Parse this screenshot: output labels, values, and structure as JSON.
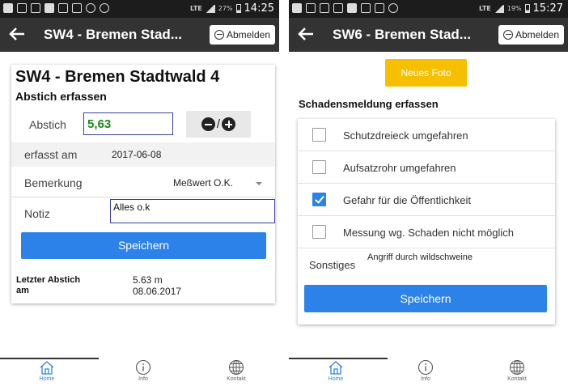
{
  "left": {
    "status": {
      "battery": "27%",
      "time": "14:25",
      "network": "LTE"
    },
    "appbar": {
      "title": "SW4 - Bremen Stad...",
      "logout_label": "Abmelden"
    },
    "page_title": "SW4 - Bremen Stadtwald 4",
    "section_title": "Abstich erfassen",
    "abstich": {
      "label": "Abstich",
      "value": "5,63",
      "stepper_separator": "/"
    },
    "erfasst": {
      "label": "erfasst am",
      "value": "2017-06-08"
    },
    "bemerkung": {
      "label": "Bemerkung",
      "selected": "Meßwert O.K."
    },
    "notiz": {
      "label": "Notiz",
      "value": "Alles o.k"
    },
    "save_label": "Speichern",
    "last": {
      "label_line1": "Letzter Abstich",
      "label_line2": "am",
      "value": "5.63 m",
      "date": "08.06.2017"
    }
  },
  "right": {
    "status": {
      "battery": "19%",
      "time": "15:27",
      "network": "LTE"
    },
    "appbar": {
      "title": "SW6 - Bremen Stad...",
      "logout_label": "Abmelden"
    },
    "photo_button": "Neues Foto",
    "section_title": "Schadensmeldung erfassen",
    "checks": [
      {
        "label": "Schutzdreieck umgefahren",
        "checked": false
      },
      {
        "label": "Aufsatzrohr umgefahren",
        "checked": false
      },
      {
        "label": "Gefahr für die Öffentlichkeit",
        "checked": true
      },
      {
        "label": "Messung wg. Schaden nicht möglich",
        "checked": false
      }
    ],
    "sonstiges": {
      "label": "Sonstiges",
      "value": "Angriff durch wildschweine"
    },
    "save_label": "Speichern"
  },
  "nav": {
    "home": "Home",
    "info": "Info",
    "kontakt": "Kontakt"
  },
  "colors": {
    "primary": "#2d82e9",
    "photo_button": "#f6c000",
    "appbar": "#333333",
    "abstich_value": "#1a8a1a"
  },
  "icons": {
    "home": "home-icon",
    "info": "info-icon",
    "kontakt": "globe-icon",
    "back": "back-arrow-icon",
    "logout": "logout-icon"
  }
}
